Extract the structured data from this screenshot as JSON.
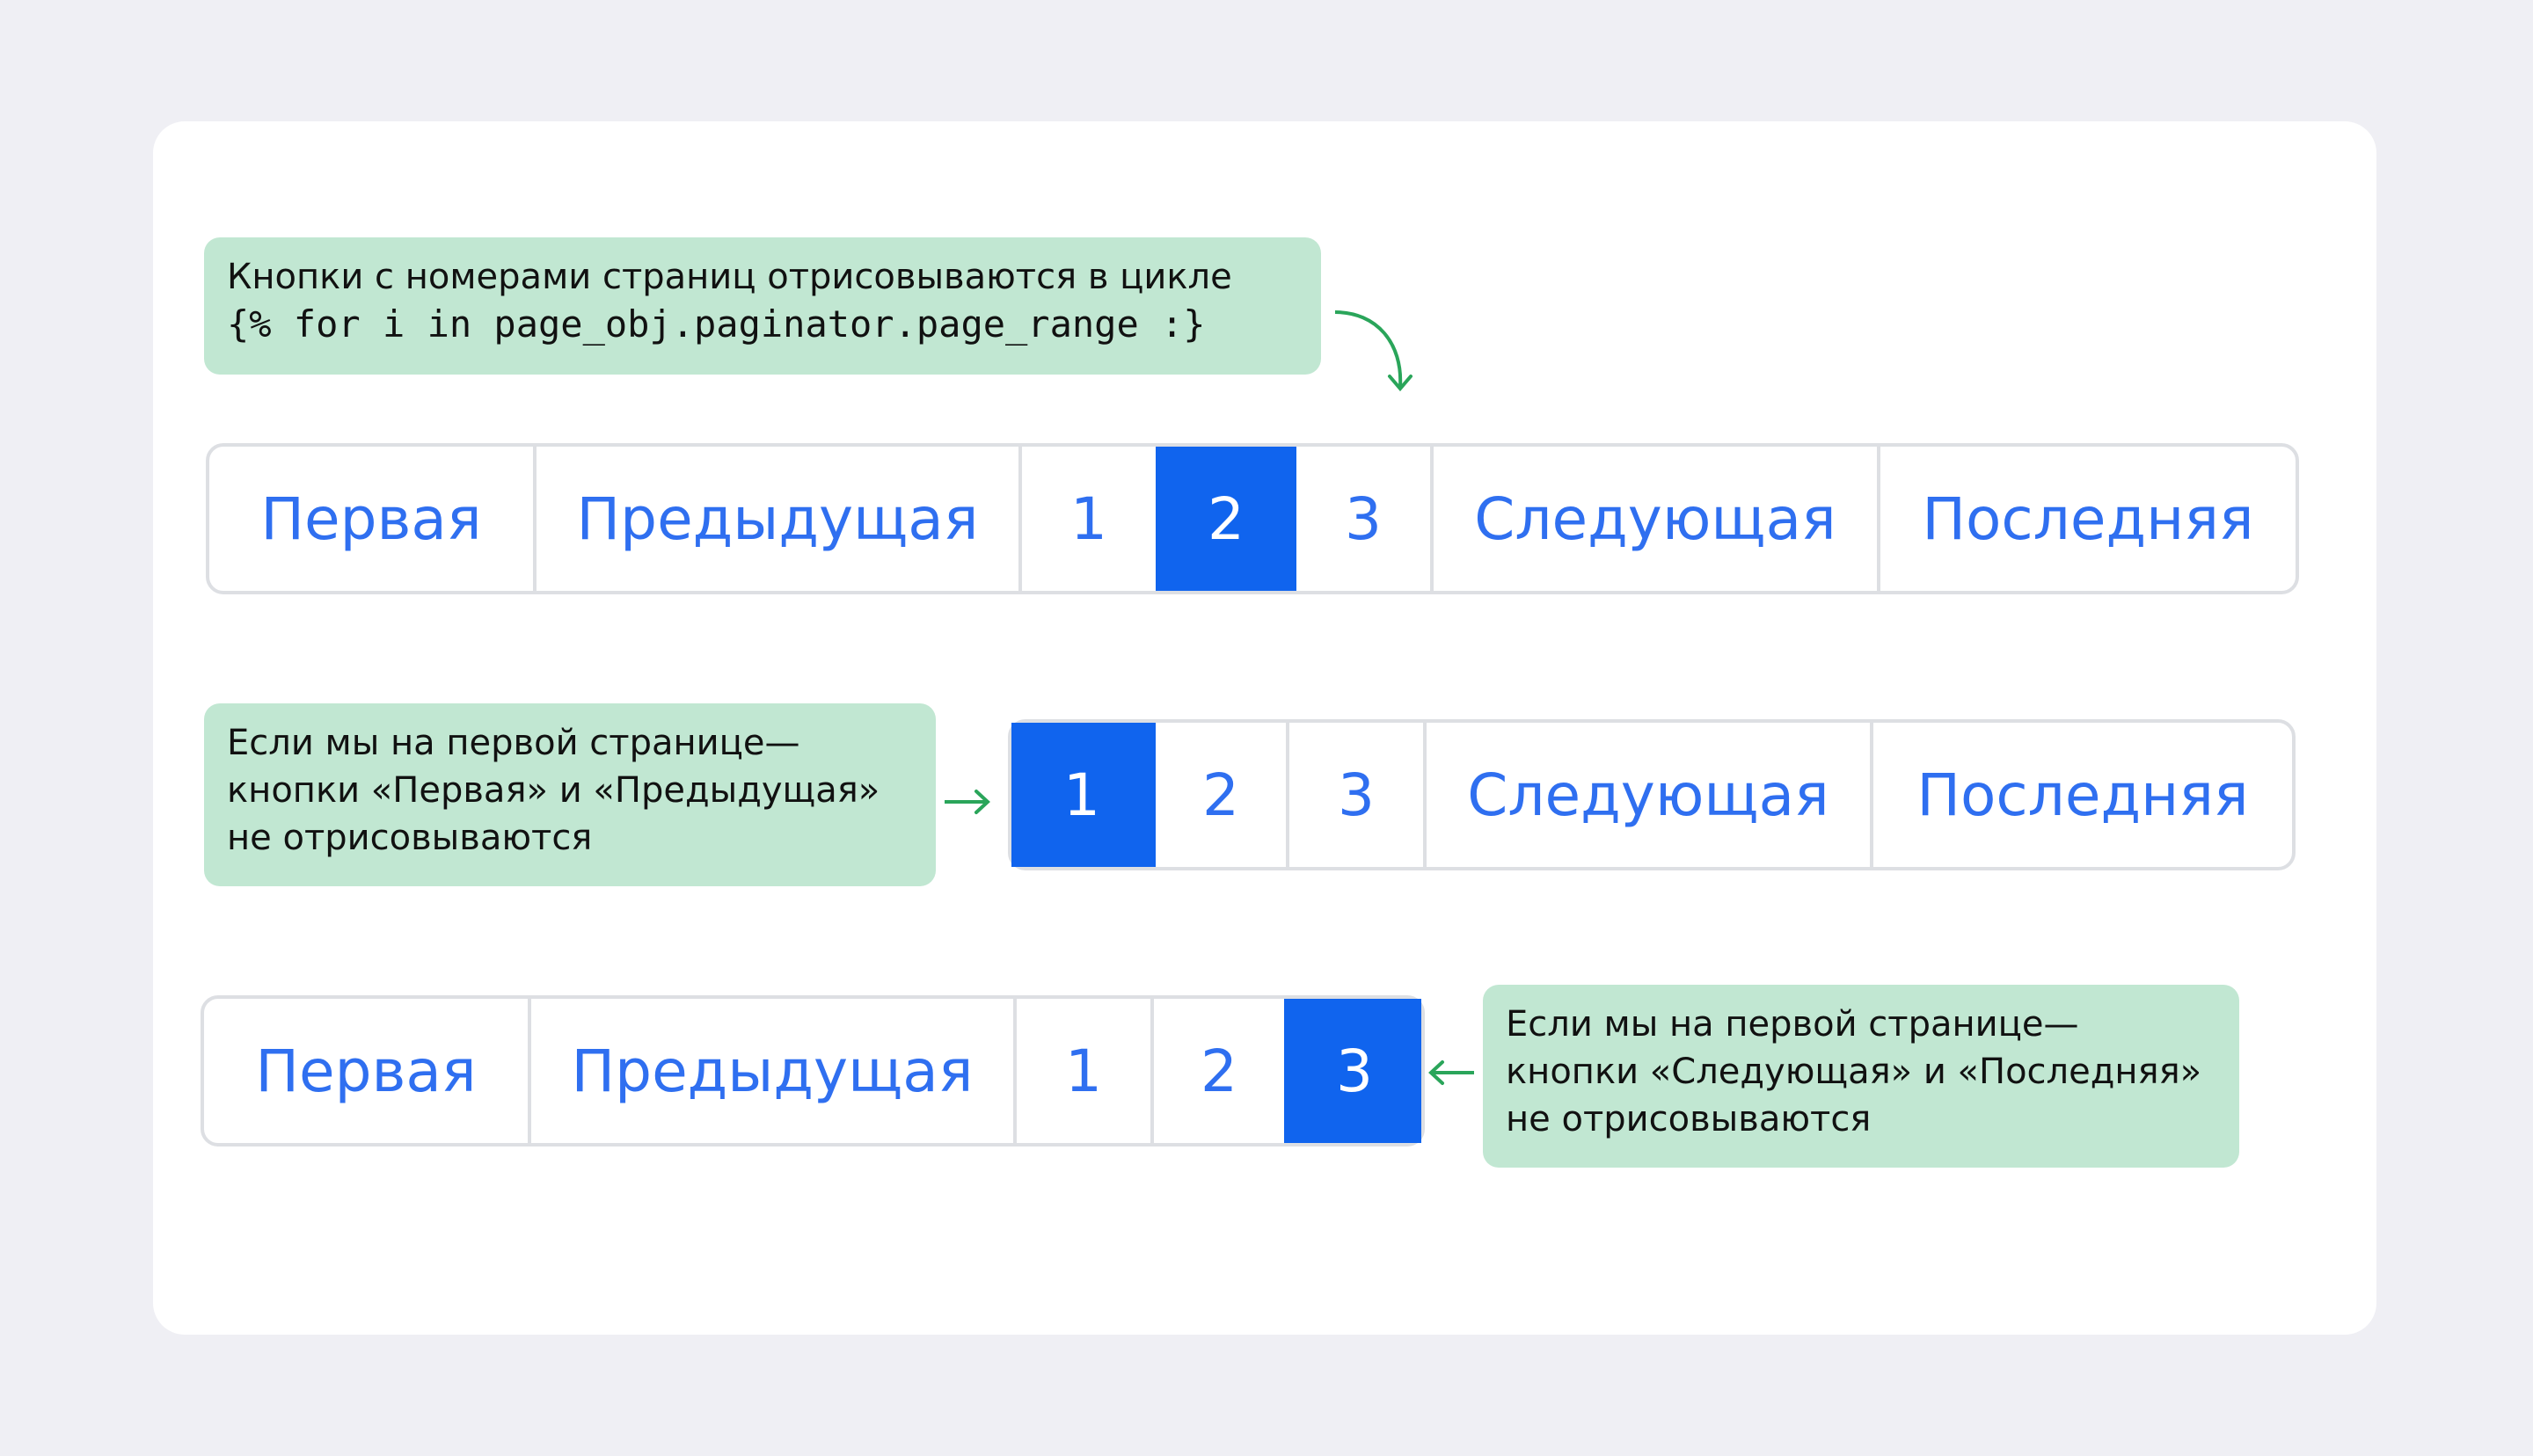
{
  "colors": {
    "accent": "#1064ee",
    "link": "#2f6ff0",
    "note_bg": "#c1e7d2",
    "arrow": "#2aa55a"
  },
  "notes": {
    "loop": {
      "line1": "Кнопки с номерами страниц отрисовываются в цикле",
      "code": "{% for i in page_obj.paginator.page_range :}"
    },
    "first_page": {
      "line1": "Если мы на первой странице—",
      "line2": "кнопки «Первая» и «Предыдущая»",
      "line3": "не отрисовываются"
    },
    "last_page": {
      "line1": "Если мы на первой странице—",
      "line2": "кнопки «Следующая» и «Последняя»",
      "line3": "не отрисовываются"
    }
  },
  "pagers": [
    {
      "current": "2",
      "buttons": [
        "Первая",
        "Предыдущая",
        "1",
        "2",
        "3",
        "Следующая",
        "Последняя"
      ]
    },
    {
      "current": "1",
      "buttons": [
        "1",
        "2",
        "3",
        "Следующая",
        "Последняя"
      ]
    },
    {
      "current": "3",
      "buttons": [
        "Первая",
        "Предыдущая",
        "1",
        "2",
        "3"
      ]
    }
  ]
}
